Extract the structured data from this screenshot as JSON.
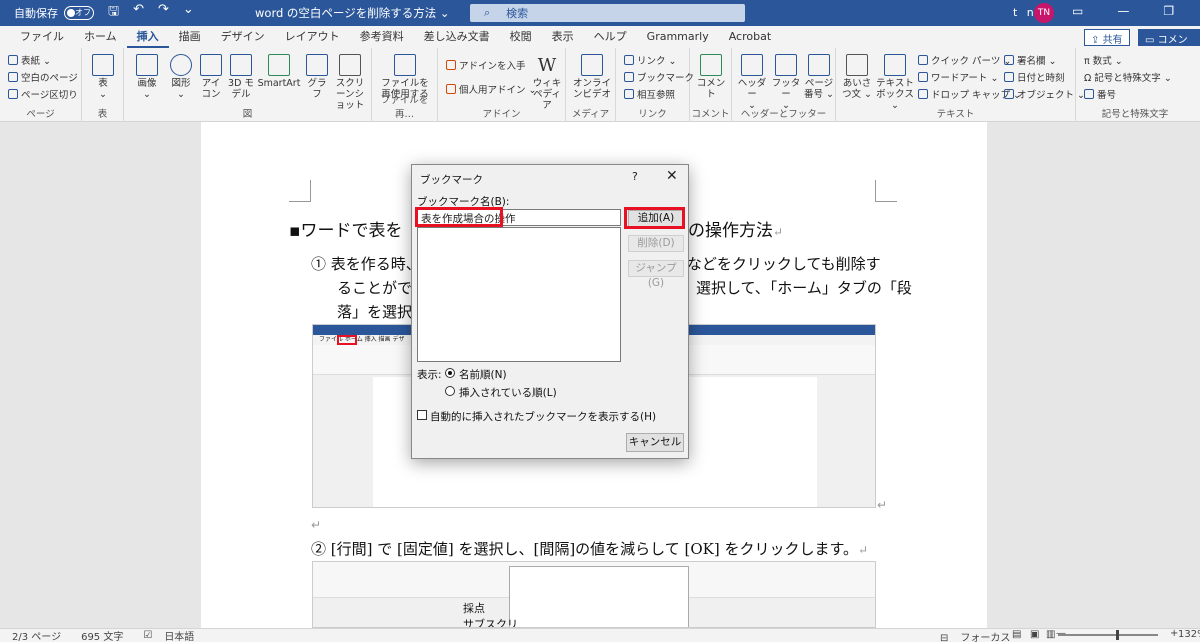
{
  "titlebar": {
    "autosave": "自動保存",
    "toggle": "オフ",
    "doc_title": "word の空白ページを削除する方法",
    "search": "検索",
    "user_initials_text": "t n",
    "avatar": "TN"
  },
  "tabs": [
    "ファイル",
    "ホーム",
    "挿入",
    "描画",
    "デザイン",
    "レイアウト",
    "参考資料",
    "差し込み文書",
    "校閲",
    "表示",
    "ヘルプ",
    "Grammarly",
    "Acrobat"
  ],
  "active_tab": "挿入",
  "share_label": "共有",
  "comment_label": "コメント",
  "ribbon": {
    "pages": {
      "items": [
        "表紙",
        "空白のページ",
        "ページ区切り"
      ],
      "label": "ページ"
    },
    "table": {
      "button": "表",
      "label": "表"
    },
    "illustrations": {
      "buttons": [
        "画像",
        "図形",
        "アイコン",
        "3D モデル",
        "SmartArt",
        "グラフ",
        "スクリーンショット"
      ],
      "label": "図"
    },
    "reuse": {
      "button": "ファイルを再使用する",
      "label": "ファイルを再…"
    },
    "addins": {
      "items": [
        "アドインを入手",
        "個人用アドイン"
      ],
      "wiki": "ウィキペディア",
      "label": "アドイン"
    },
    "media": {
      "button": "オンラインビデオ",
      "label": "メディア"
    },
    "links": {
      "items": [
        "リンク",
        "ブックマーク",
        "相互参照"
      ],
      "label": "リンク"
    },
    "comments": {
      "button": "コメント",
      "label": "コメント"
    },
    "header_footer": {
      "buttons": [
        "ヘッダー",
        "フッター",
        "ページ番号"
      ],
      "label": "ヘッダーとフッター"
    },
    "text": {
      "buttons": [
        "あいさつ文",
        "テキストボックス"
      ],
      "items": [
        "クイック パーツ",
        "ワードアート",
        "ドロップ キャップ"
      ],
      "items2": [
        "署名欄",
        "日付と時刻",
        "オブジェクト"
      ],
      "label": "テキスト"
    },
    "symbols": {
      "items": [
        "数式",
        "記号と特殊文字",
        "番号"
      ],
      "label": "記号と特殊文字"
    }
  },
  "document": {
    "heading": "▪ワードで表を",
    "heading_tail": "の操作方法",
    "step1_line1_a": "① 表を作る時、",
    "step1_line1_b": "]などをクリックしても削除す",
    "step1_line2_a": "ることができ",
    "step1_line2_b": "選択して、「ホーム」タブの「段",
    "step1_line3": "落」を選択し",
    "step2": "② [行間] で [固定値] を選択し、[間隔]の値を減らして [OK] をクリックします。",
    "cell1": "採点",
    "cell2": "サブスクリ"
  },
  "dialog": {
    "title": "ブックマーク",
    "help": "?",
    "close": "✕",
    "name_label": "ブックマーク名(B):",
    "name_value": "表を作成場合の操作",
    "add": "追加(A)",
    "delete": "削除(D)",
    "jump": "ジャンプ(G)",
    "sort_label": "表示:",
    "sort_name": "名前順(N)",
    "sort_location": "挿入されている順(L)",
    "hidden_label": "自動的に挿入されたブックマークを表示する(H)",
    "cancel": "キャンセル"
  },
  "status": {
    "page": "2/3 ページ",
    "words": "695 文字",
    "lang": "日本語",
    "focus": "フォーカス",
    "zoom": "132%"
  }
}
